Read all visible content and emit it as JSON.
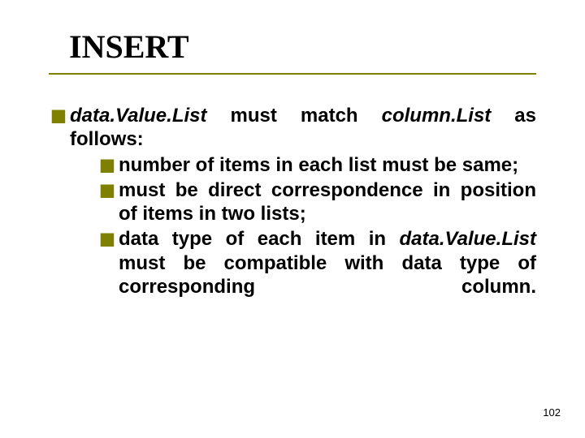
{
  "title": "INSERT",
  "main": {
    "part1_italic": "data.Value.List",
    "part2": " must match ",
    "part3_italic": "column.List",
    "part4": " as follows:"
  },
  "sub": {
    "0": "number of items in each list must be same;",
    "1": "must be direct correspondence in position of items in two lists;"
  },
  "sub2": {
    "a": "data type of each item in ",
    "b_italic": "data.Value.List",
    "c": " must be compatible with data type of corresponding column."
  },
  "page": "102"
}
